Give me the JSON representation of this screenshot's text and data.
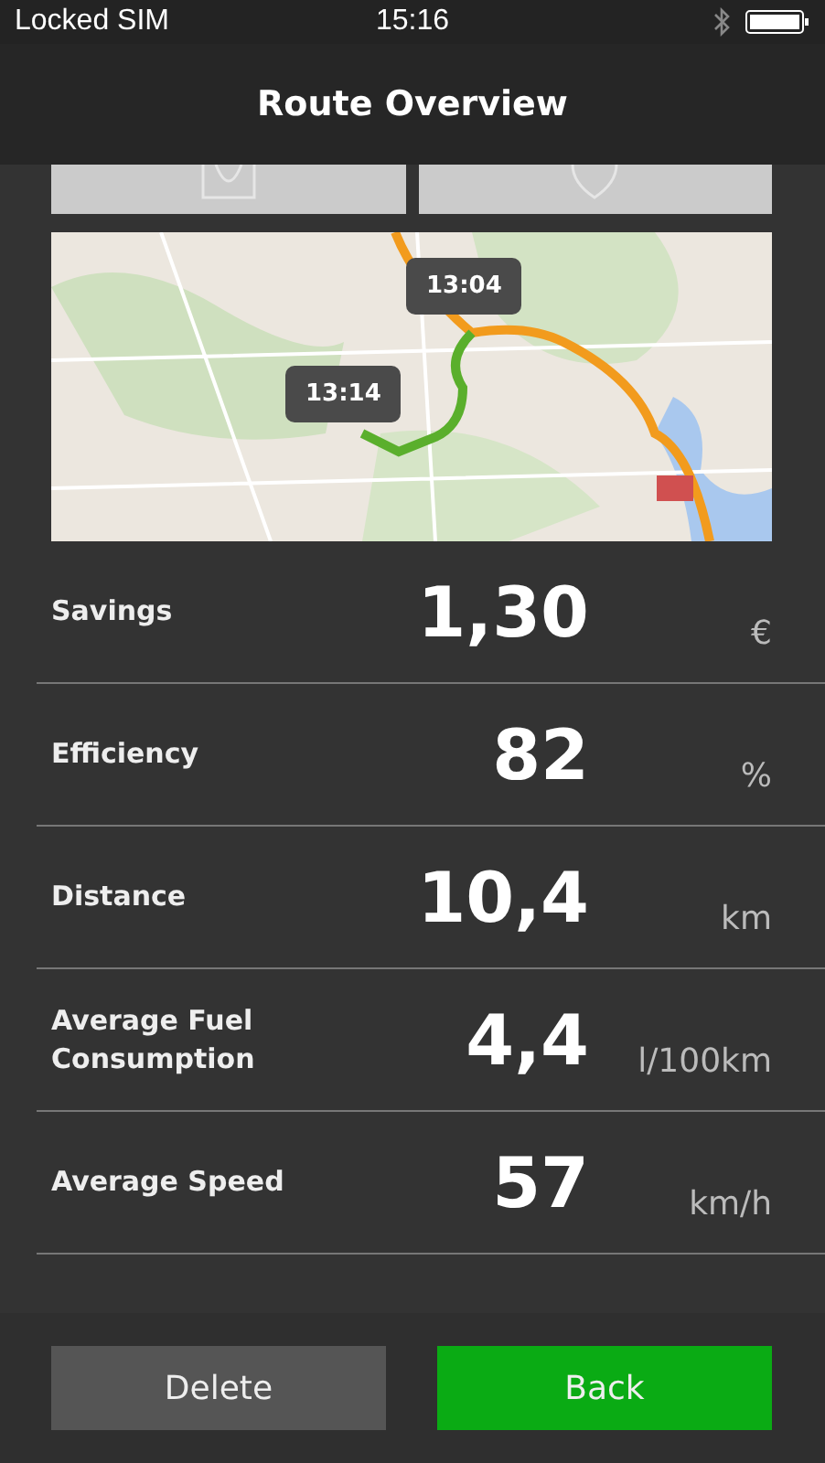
{
  "status_bar": {
    "carrier": "Locked SIM",
    "time": "15:16"
  },
  "nav_bar": {
    "title": "Route Overview"
  },
  "map": {
    "kind": "picture",
    "markers": [
      {
        "time": "13:04"
      },
      {
        "time": "13:14"
      }
    ]
  },
  "stats": [
    {
      "label": "Savings",
      "value": "1,30",
      "unit": "€"
    },
    {
      "label": "Efficiency",
      "value": "82",
      "unit": "%"
    },
    {
      "label": "Distance",
      "value": "10,4",
      "unit": "km"
    },
    {
      "label": "Average Fuel Consumption",
      "value": "4,4",
      "unit": "l/100km"
    },
    {
      "label": "Average Speed",
      "value": "57",
      "unit": "km/h"
    }
  ],
  "buttons": [
    {
      "label": "Delete",
      "kind": "secondary"
    },
    {
      "label": "Back",
      "kind": "primary"
    }
  ]
}
